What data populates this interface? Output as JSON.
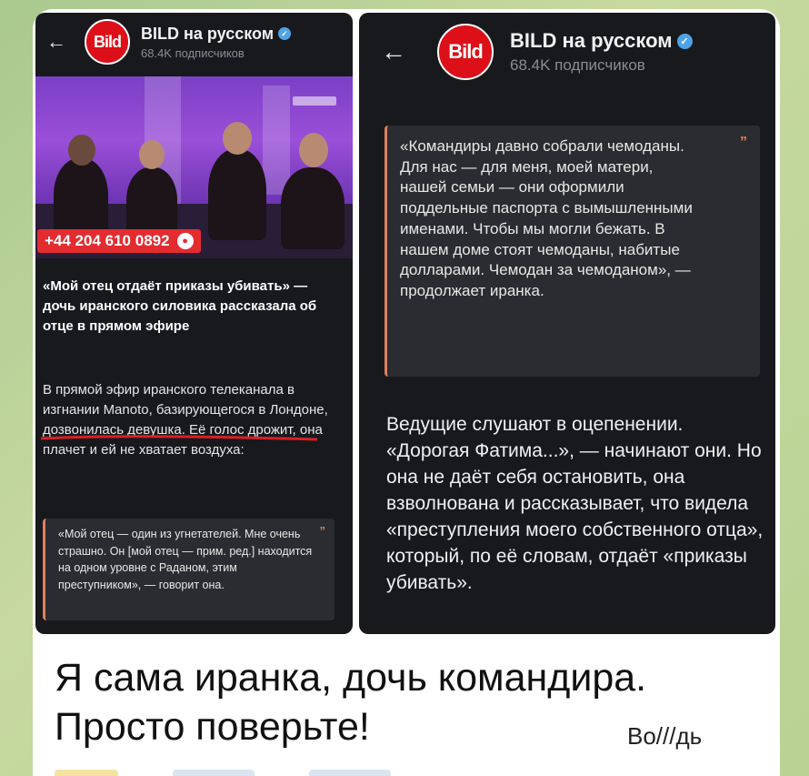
{
  "left": {
    "header": {
      "channel_name": "BILD на русском",
      "subscribers": "68.4K подписчиков",
      "logo_text": "Bild"
    },
    "phone_banner": "+44 204 610 0892",
    "headline": "«Мой отец отдаёт приказы убивать» — дочь иранского силовика рассказала об отце в прямом эфире",
    "body": "В прямой эфир иранского телеканала в изгнании Manoto, базирующегося в Лондоне, дозвонилась девушка. Её голос дрожит, она плачет и ей не хватает воздуха:",
    "quote": "«Мой отец — один из угнетателей. Мне очень страшно. Он [мой отец — прим. ред.] находится на одном уровне с Раданом, этим преступником», — говорит она."
  },
  "right": {
    "header": {
      "channel_name": "BILD на русском",
      "subscribers": "68.4K подписчиков",
      "logo_text": "Bild"
    },
    "quote": "«Командиры давно собрали чемоданы. Для нас — для меня, моей матери, нашей семьи — они оформили поддельные паспорта с вымышленными именами. Чтобы мы могли бежать. В нашем доме стоят чемоданы, набитые долларами. Чемодан за чемоданом», — продолжает иранка.",
    "body": "Ведущие слушают в оцепенении. «Дорогая Фатима...», — начинают они. Но она не даёт себя остановить, она взволнована и рассказывает, что видела «преступления моего собственного отца», который, по её словам, отдаёт «приказы убивать»."
  },
  "caption": {
    "line1": "Я сама иранка, дочь командира.",
    "line2": "Просто поверьте!",
    "signature": "Во///дь"
  },
  "icons": {
    "back": "back-arrow-icon",
    "verified": "verified-badge-icon",
    "quote": "quote-mark-icon",
    "mic": "microphone-icon"
  },
  "colors": {
    "panel_bg": "#18191d",
    "quote_accent": "#e0805f",
    "bild_red": "#dd0f18",
    "verified_blue": "#4ea3e6",
    "banner_red": "#e32c2f"
  }
}
